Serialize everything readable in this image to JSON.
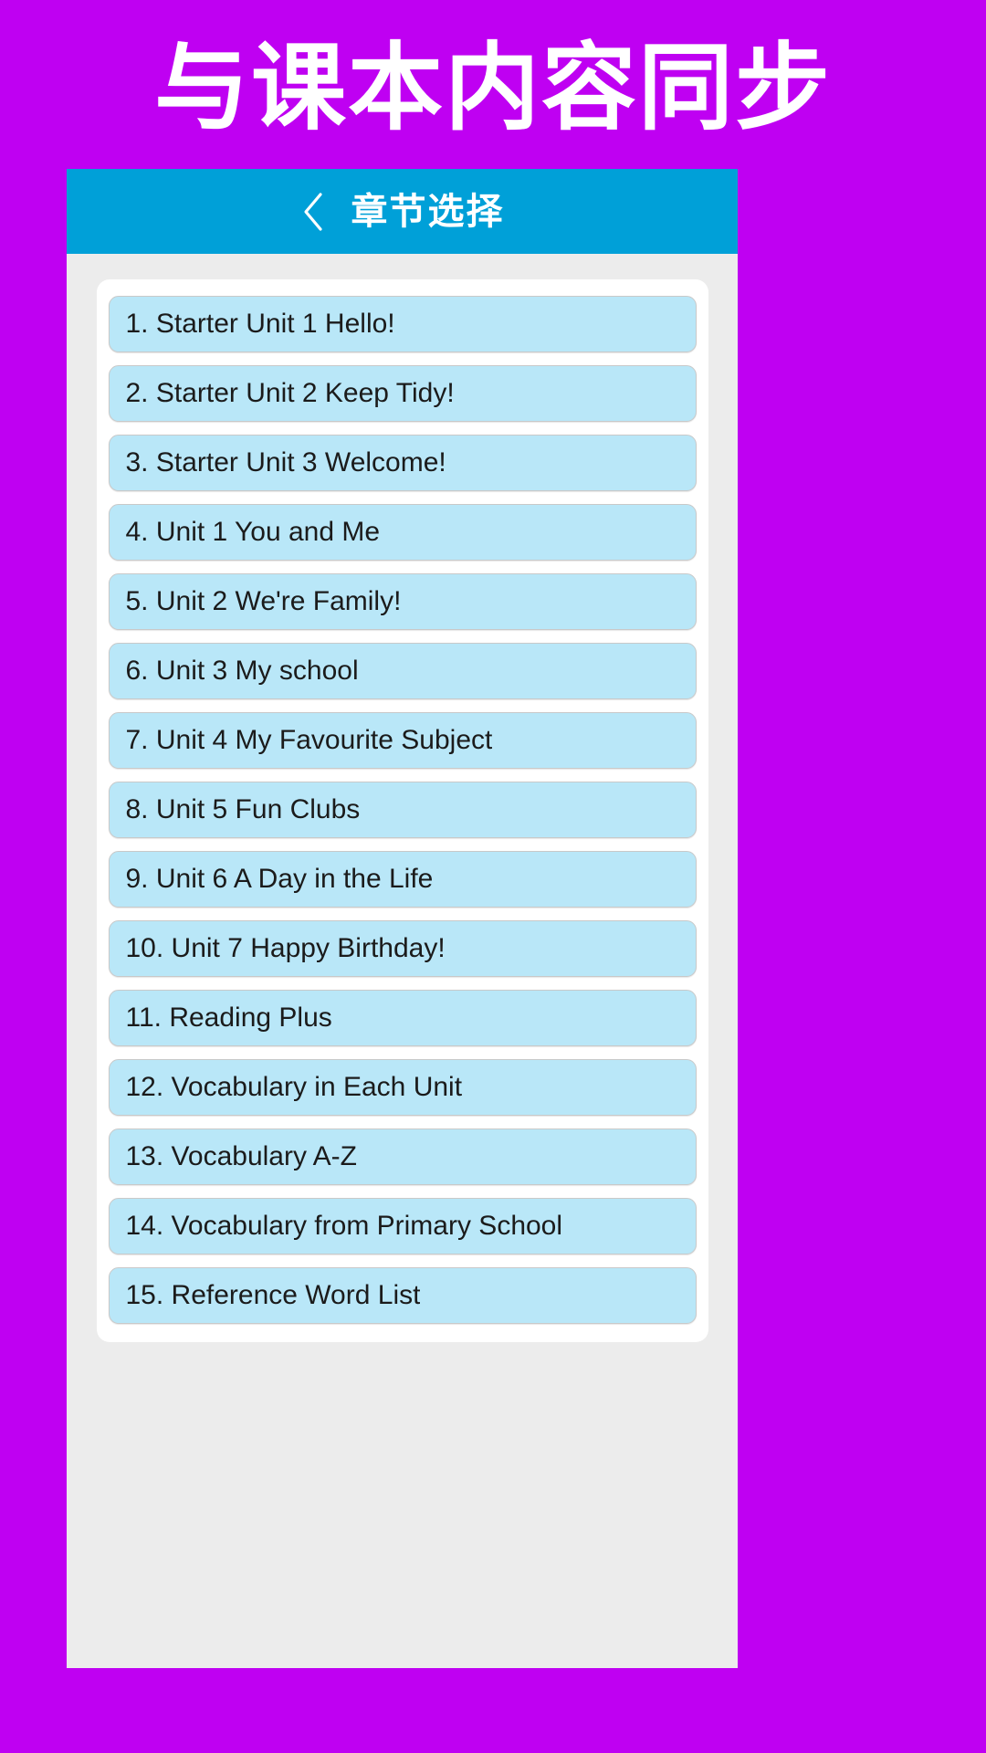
{
  "promo": {
    "heading": "与课本内容同步",
    "background_color": "#bf00f2",
    "text_color": "#ffffff"
  },
  "app_bar": {
    "back_icon": "chevron-left-icon",
    "title": "章节选择",
    "background_color": "#00a0d8",
    "text_color": "#ffffff"
  },
  "screen": {
    "background_color": "#ececec",
    "card_background_color": "#ffffff"
  },
  "chapter_list": {
    "item_background_color": "#b9e7f8",
    "item_border_color": "#c9c9c9",
    "item_text_color": "#1b1b1b",
    "items": [
      {
        "label": "1. Starter Unit 1 Hello!"
      },
      {
        "label": "2. Starter Unit 2 Keep Tidy!"
      },
      {
        "label": "3. Starter Unit 3 Welcome!"
      },
      {
        "label": "4. Unit 1 You and Me"
      },
      {
        "label": "5. Unit 2 We're Family!"
      },
      {
        "label": "6. Unit 3 My school"
      },
      {
        "label": "7. Unit 4 My Favourite Subject"
      },
      {
        "label": "8. Unit 5 Fun Clubs"
      },
      {
        "label": "9. Unit 6 A Day in the Life"
      },
      {
        "label": "10. Unit 7 Happy Birthday!"
      },
      {
        "label": "11. Reading Plus"
      },
      {
        "label": "12. Vocabulary in Each Unit"
      },
      {
        "label": "13. Vocabulary A-Z"
      },
      {
        "label": "14. Vocabulary from Primary School"
      },
      {
        "label": "15. Reference Word List"
      }
    ]
  }
}
